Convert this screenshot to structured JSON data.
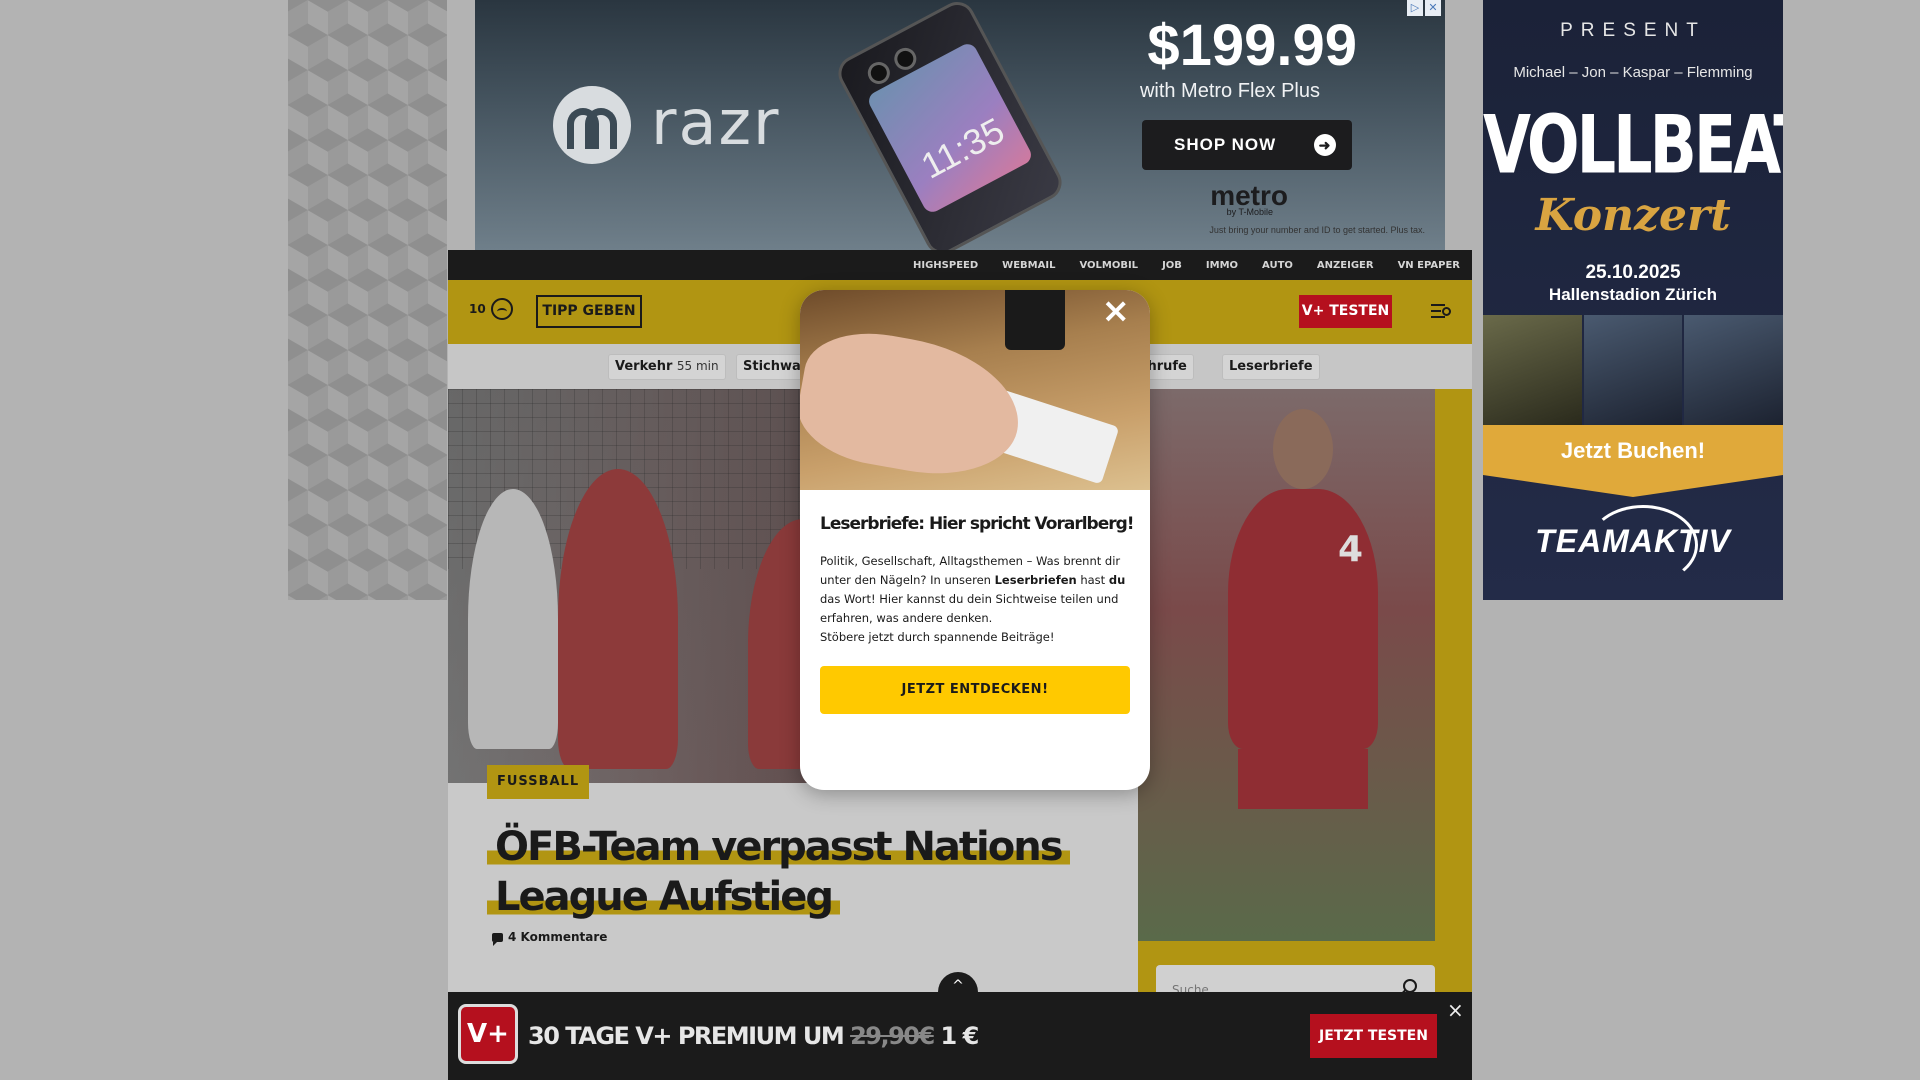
{
  "top_ad": {
    "brand": "razr",
    "phone_time": "11:35",
    "price": "$199.99",
    "price_sub": "with Metro Flex Plus",
    "cta": "SHOP NOW",
    "carrier": "metro",
    "carrier_sub": "by T-Mobile",
    "fine_print": "Just bring your number and ID to get started. Plus tax."
  },
  "right_ad": {
    "present": "PRESENT",
    "names": "Michael – Jon – Kaspar – Flemming",
    "band": "VOLLBEAT",
    "konzert": "Konzert",
    "date": "25.10.2025",
    "venue": "Hallenstadion Zürich",
    "cta": "Jetzt Buchen!",
    "organizer": "TEAMAKTIV"
  },
  "topbar": {
    "links": [
      "HIGHSPEED",
      "WEBMAIL",
      "VOLMOBIL",
      "JOB",
      "IMMO",
      "AUTO",
      "ANZEIGER",
      "VN EPAPER"
    ]
  },
  "header": {
    "weather_temp": "10",
    "tipp_label": "TIPP GEBEN",
    "vplus_label": "V+ TESTEN"
  },
  "subnav": {
    "verkehr": "Verkehr",
    "verkehr_time": "55 min",
    "stichwort": "Stichwa",
    "nachrufe": "achrufe",
    "leserbriefe": "Leserbriefe"
  },
  "article": {
    "category": "FUSSBALL",
    "headline_line1": "ÖFB-Team verpasst Nations",
    "headline_line2": "League Aufstieg",
    "comments": "4 Kommentare",
    "player_number": "4"
  },
  "sidebar": {
    "search_placeholder": "Suche"
  },
  "modal": {
    "title": "Leserbriefe: Hier spricht Vorarlberg!",
    "body_1": "Politik, Gesellschaft, Alltagsthemen – Was brennt dir unter den Nägeln? In unseren ",
    "body_bold1": "Leserbriefen",
    "body_2": " hast ",
    "body_bold2": "du",
    "body_3": " das Wort! Hier kannst du dein Sichtweise teilen und erfahren, was andere denken.",
    "body_4": "Stöbere jetzt durch spannende Beiträge!",
    "cta": "JETZT ENTDECKEN!",
    "close": "×"
  },
  "promo": {
    "logo": "V+",
    "text_prefix": "30 TAGE V+ PREMIUM UM ",
    "old_price": "29,90€",
    "new_price": " 1 €",
    "cta": "JETZT TESTEN",
    "close": "×"
  },
  "scroll_top": "^"
}
